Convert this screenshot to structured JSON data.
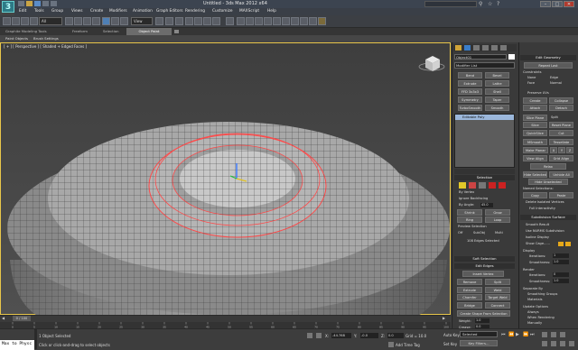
{
  "window": {
    "title": "Untitled - 3ds Max 2012 x64"
  },
  "menu": [
    "Edit",
    "Tools",
    "Group",
    "Views",
    "Create",
    "Modifiers",
    "Animation",
    "Graph Editors",
    "Rendering",
    "Customize",
    "MAXScript",
    "Help"
  ],
  "toolbar": {
    "selection_filter": "All",
    "view_dropdown": "View"
  },
  "ribbon": {
    "tabs": [
      "Graphite Modeling Tools",
      "Freeform",
      "Selection",
      "Object Paint"
    ],
    "active_tab": "Object Paint",
    "subtabs": [
      "Paint Objects",
      "Brush Settings"
    ]
  },
  "viewport": {
    "label": "[ + ] [ Perspective ] [ Shaded + Edged Faces ]"
  },
  "command_panel": {
    "object_name": "Object01",
    "modifier_list": "Modifier List",
    "modifier_buttons": [
      [
        "Bend",
        "Bevel"
      ],
      [
        "Extrude",
        "Lathe"
      ],
      [
        "FFD 3x3x3",
        "Shell"
      ],
      [
        "Symmetry",
        "Taper"
      ],
      [
        "TurboSmooth",
        "Smooth"
      ]
    ],
    "stack_item": "Editable Poly",
    "selection_header": "Selection",
    "by_vertex": "By Vertex",
    "ignore_backfacing": "Ignore Backfacing",
    "by_angle": "By Angle:",
    "by_angle_value": "45.0",
    "shrink": "Shrink",
    "grow": "Grow",
    "ring": "Ring",
    "loop": "Loop",
    "preview_selection": "Preview Selection",
    "preview_options": [
      "Off",
      "SubObj",
      "Multi"
    ],
    "edges_selected": "108 Edges Selected",
    "soft_selection": "Soft Selection",
    "edit_edges": "Edit Edges",
    "insert_vertex": "Insert Vertex",
    "edge_ops": [
      [
        "Remove",
        "Split"
      ],
      [
        "Extrude",
        "Weld"
      ],
      [
        "Chamfer",
        "Target Weld"
      ],
      [
        "Bridge",
        "Connect"
      ]
    ],
    "create_shape": "Create Shape From Selection",
    "weight": "Weight:",
    "weight_value": "1.0",
    "crease": "Crease:",
    "crease_value": "0.0"
  },
  "right_panel": {
    "edit_geometry": "Edit Geometry",
    "repeat_last": "Repeat Last",
    "constraints": "Constraints",
    "constraint_opts": [
      "None",
      "Edge",
      "Face",
      "Normal"
    ],
    "preserve_uvs": "Preserve UVs",
    "geo_buttons": [
      [
        "Create",
        "Collapse"
      ],
      [
        "Attach",
        "Detach"
      ]
    ],
    "slice_plane": "Slice Plane",
    "split": "Split",
    "slice": "Slice",
    "reset_plane": "Reset Plane",
    "quickslice": "QuickSlice",
    "cut": "Cut",
    "msmooth": "MSmooth",
    "tessellate": "Tessellate",
    "make_planar": "Make Planar",
    "xyz": [
      "X",
      "Y",
      "Z"
    ],
    "view_align": "View Align",
    "grid_align": "Grid Align",
    "relax": "Relax",
    "hide_selected": "Hide Selected",
    "unhide_all": "Unhide All",
    "hide_unselected": "Hide Unselected",
    "named_selections": "Named Selections:",
    "copy": "Copy",
    "paste": "Paste",
    "delete_isolated": "Delete Isolated Vertices",
    "full_interactivity": "Full Interactivity",
    "subdivision_surface": "Subdivision Surface",
    "smooth_result": "Smooth Result",
    "use_nurms": "Use NURMS Subdivision",
    "isoline": "Isoline Display",
    "show_cage": "Show Cage......",
    "display": "Display",
    "iterations_label": "Iterations:",
    "iterations": "1",
    "smoothness_label": "Smoothness:",
    "smoothness": "1.0",
    "render": "Render",
    "render_iterations": "0",
    "render_smoothness": "1.0",
    "separate_by": "Separate By",
    "smoothing_groups": "Smoothing Groups",
    "materials": "Materials",
    "update_options": "Update Options",
    "update_opts": [
      "Always",
      "When Rendering",
      "Manually"
    ]
  },
  "timeline": {
    "frame": "0 / 100",
    "ticks": [
      "0",
      "5",
      "10",
      "15",
      "20",
      "25",
      "30",
      "35",
      "40",
      "45",
      "50",
      "55",
      "60",
      "65",
      "70",
      "75",
      "80",
      "85",
      "90",
      "95",
      "100"
    ]
  },
  "status": {
    "maxscript": "Max to Physc",
    "objects_selected": "1 Object Selected",
    "prompt": "Click or click-and-drag to select objects",
    "x_label": "X:",
    "x_value": "-44.768",
    "y_label": "Y:",
    "y_value": "-0.0",
    "z_label": "Z:",
    "z_value": "0.0",
    "grid": "Grid = 10.0",
    "auto_key": "Auto Key",
    "selected": "Selected",
    "set_key": "Set Key",
    "key_filters": "Key Filters...",
    "add_time_tag": "Add Time Tag"
  },
  "colors": {
    "accent": "#e8c64a",
    "edge_select": "#ff4a4a",
    "viewport_bg": "#4a4a4a"
  }
}
